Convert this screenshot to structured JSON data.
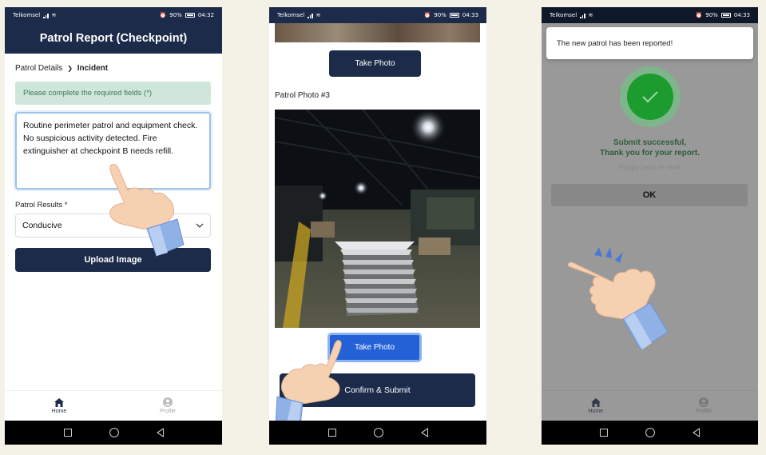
{
  "status": {
    "carrier": "Telkomsel",
    "battery": "90%",
    "time1": "04:32",
    "time2": "04:33",
    "time3": "04:33"
  },
  "screen1": {
    "title": "Patrol Report (Checkpoint)",
    "breadcrumb_parent": "Patrol Details",
    "breadcrumb_sep": "❯",
    "breadcrumb_current": "Incident",
    "alert": "Please complete the required fields (*)",
    "incident_text": "Routine perimeter patrol and equipment check. No suspicious activity detected. Fire extinguisher at checkpoint B needs refill.",
    "results_label": "Patrol Results *",
    "results_value": "Conducive",
    "upload_label": "Upload Image"
  },
  "screen2": {
    "take_photo_label": "Take Photo",
    "photo_label": "Patrol Photo #3",
    "take_photo_label_2": "Take Photo",
    "confirm_label": "Confirm & Submit"
  },
  "screen3": {
    "toast": "The new patrol has been reported!",
    "success_line1": "Submit successful,",
    "success_line2": "Thank you for your report.",
    "sub_text": "Happy back to work",
    "ok_label": "OK"
  },
  "tabs": {
    "home": "Home",
    "profile": "Profile"
  },
  "colors": {
    "primary": "#1c2b4a",
    "success": "#1c9c2e",
    "alert_bg": "#cfe6da",
    "active_button": "#2461d6",
    "background": "#f4f1e6"
  }
}
